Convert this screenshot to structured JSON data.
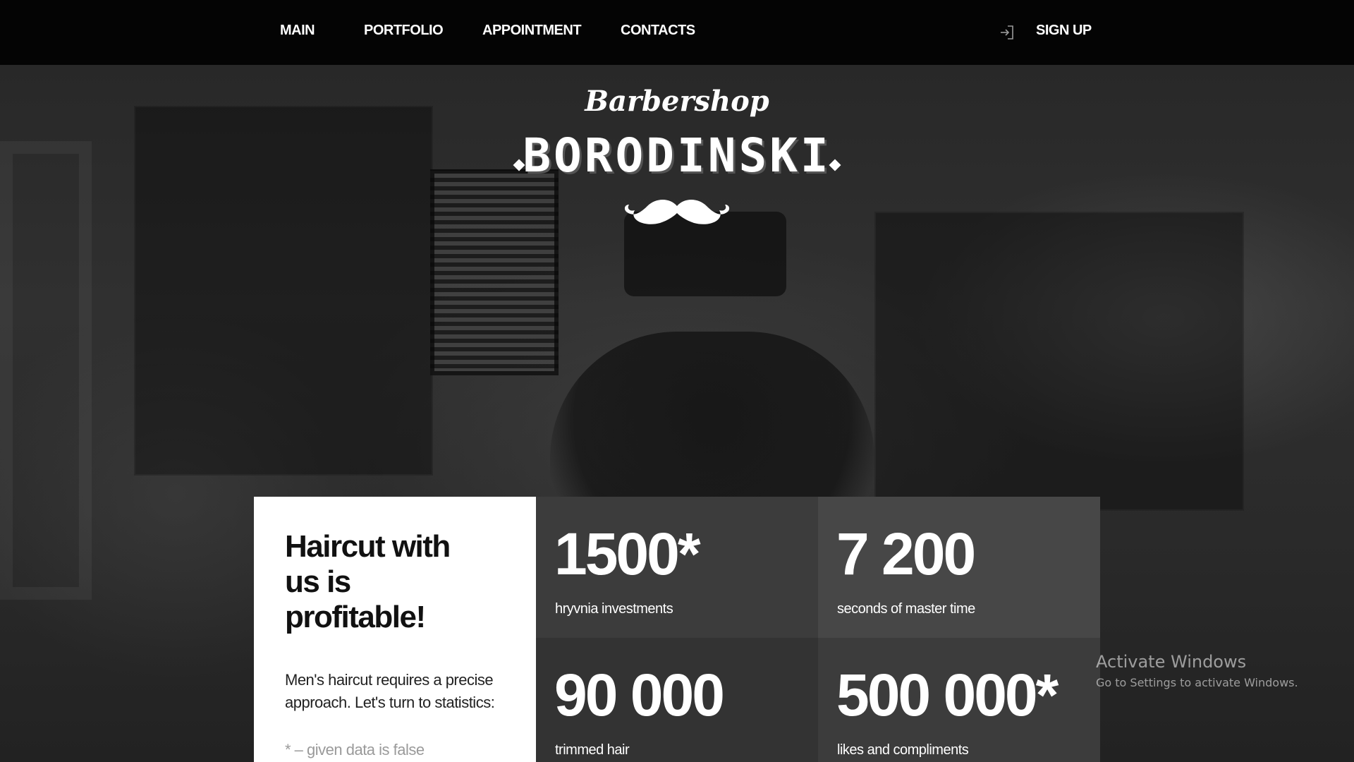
{
  "nav": {
    "items": [
      {
        "label": "MAIN"
      },
      {
        "label": "PORTFOLIO"
      },
      {
        "label": "APPOINTMENT"
      },
      {
        "label": "CONTACTS"
      }
    ],
    "signup_label": "SIGN UP",
    "login_icon": "login-arrow-icon"
  },
  "logo": {
    "script": "Barbershop",
    "title": "BORODINSKI",
    "icon": "mustache-icon"
  },
  "intro": {
    "heading": "Haircut with us is profitable!",
    "text": "Men's haircut requires a precise approach. Let's turn to statistics:",
    "note": "* – given data is false"
  },
  "stats": [
    {
      "value": "1500*",
      "label": "hryvnia investments"
    },
    {
      "value": "7 200",
      "label": "seconds of master time"
    },
    {
      "value": "90 000",
      "label": "trimmed hair"
    },
    {
      "value": "500 000*",
      "label": "likes and compliments"
    }
  ],
  "watermark": {
    "title": "Activate Windows",
    "subtitle": "Go to Settings to activate Windows."
  },
  "colors": {
    "nav_bg": "#040404",
    "card_white": "#ffffff",
    "stat_tiles": [
      "#3c3c3c",
      "#474747",
      "#333333",
      "#3c3c3c"
    ]
  }
}
